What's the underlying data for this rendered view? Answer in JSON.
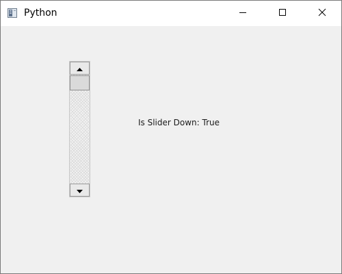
{
  "window": {
    "title": "Python",
    "app_icon": "python-window-icon",
    "controls": {
      "minimize_icon": "minimize-icon",
      "maximize_icon": "maximize-icon",
      "close_icon": "close-icon"
    }
  },
  "scrollbar": {
    "orientation": "vertical",
    "slider_position": 0,
    "up_arrow_icon": "arrow-up-icon",
    "down_arrow_icon": "arrow-down-icon"
  },
  "status": {
    "text": "Is Slider Down: True"
  },
  "colors": {
    "window_background": "#f0f0f0",
    "titlebar_background": "#ffffff",
    "border": "#7a7a7a"
  }
}
